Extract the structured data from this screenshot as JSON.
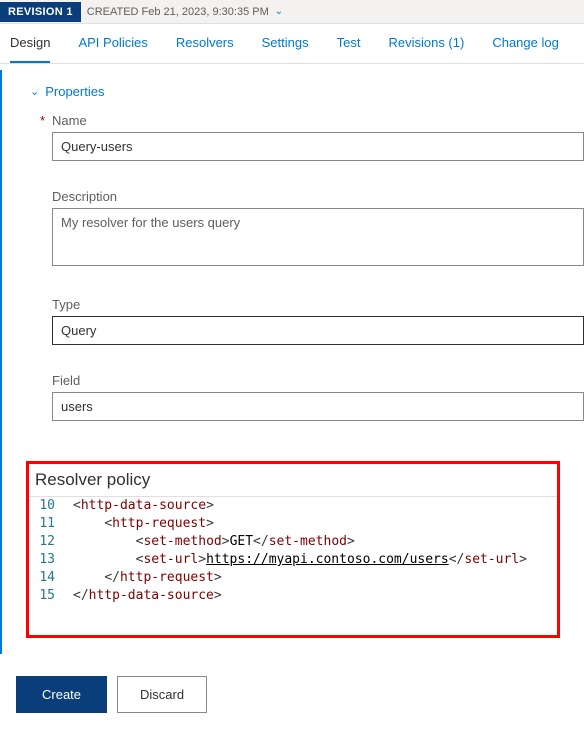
{
  "revision": {
    "badge": "REVISION 1",
    "created": "CREATED Feb 21, 2023, 9:30:35 PM"
  },
  "tabs": {
    "design": "Design",
    "api_policies": "API Policies",
    "resolvers": "Resolvers",
    "settings": "Settings",
    "test": "Test",
    "revisions": "Revisions (1)",
    "change_log": "Change log"
  },
  "section": {
    "properties": "Properties"
  },
  "form": {
    "name_label": "Name",
    "name_value": "Query-users",
    "description_label": "Description",
    "description_value": "My resolver for the users query",
    "type_label": "Type",
    "type_value": "Query",
    "field_label": "Field",
    "field_value": "users"
  },
  "resolver": {
    "title": "Resolver policy"
  },
  "code": {
    "l10": {
      "num": "10",
      "tag": "http-data-source"
    },
    "l11": {
      "num": "11",
      "tag": "http-request"
    },
    "l12": {
      "num": "12",
      "tag": "set-method",
      "text": "GET"
    },
    "l13": {
      "num": "13",
      "tag": "set-url",
      "url": "https://myapi.contoso.com/users"
    },
    "l14": {
      "num": "14",
      "tag": "http-request"
    },
    "l15": {
      "num": "15",
      "tag": "http-data-source"
    }
  },
  "buttons": {
    "create": "Create",
    "discard": "Discard"
  }
}
